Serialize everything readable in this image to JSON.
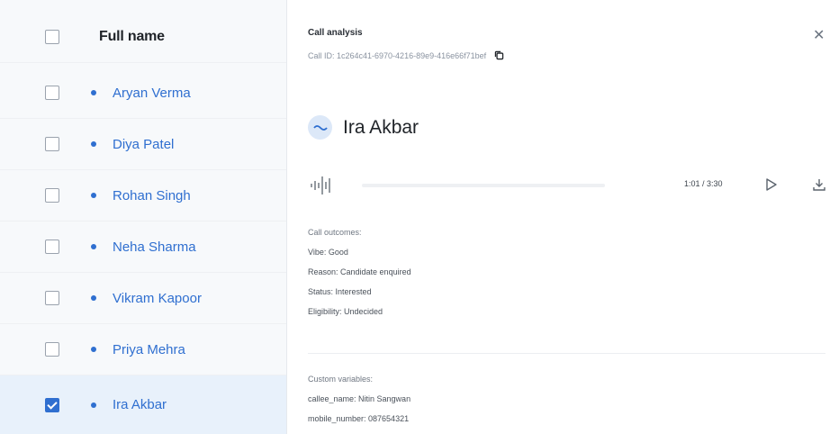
{
  "table": {
    "header_label": "Full name",
    "rows": [
      {
        "name": "Aryan Verma",
        "checked": false
      },
      {
        "name": "Diya Patel",
        "checked": false
      },
      {
        "name": "Rohan Singh",
        "checked": false
      },
      {
        "name": "Neha Sharma",
        "checked": false
      },
      {
        "name": "Vikram Kapoor",
        "checked": false
      },
      {
        "name": "Priya Mehra",
        "checked": false
      },
      {
        "name": "Ira Akbar",
        "checked": true
      }
    ]
  },
  "panel": {
    "title": "Call analysis",
    "call_id": "Call ID: 1c264c41-6970-4216-89e9-416e66f71bef",
    "caller_name": "Ira Akbar",
    "player": {
      "time": "1:01 / 3:30"
    },
    "outcomes": {
      "heading": "Call outcomes:",
      "vibe": "Vibe: Good",
      "reason": "Reason: Candidate enquired",
      "status": "Status: Interested",
      "eligibility": "Eligibility: Undecided"
    },
    "custom": {
      "heading": "Custom variables:",
      "callee_name": "callee_name: Nitin Sangwan",
      "mobile_number": "mobile_number: 087654321"
    }
  },
  "icons": {
    "close": "close-icon",
    "copy": "copy-icon",
    "avatar": "voice-wave-icon",
    "waveform": "waveform-icon",
    "play": "play-icon",
    "download": "download-icon"
  },
  "colors": {
    "accent": "#2f6fd0",
    "selected_row": "#e8f1fb"
  }
}
